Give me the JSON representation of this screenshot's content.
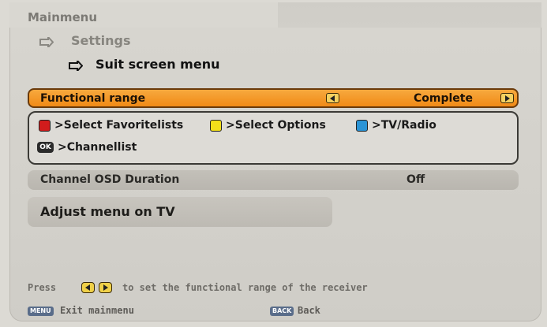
{
  "breadcrumb": {
    "main": "Mainmenu",
    "settings": "Settings",
    "current": "Suit screen menu"
  },
  "functional_range": {
    "label": "Functional range",
    "value": "Complete"
  },
  "legend": {
    "red": ">Select Favoritelists",
    "yellow": ">Select Options",
    "blue": ">TV/Radio",
    "ok_key": "OK",
    "ok": ">Channellist"
  },
  "osd": {
    "label": "Channel OSD Duration",
    "value": "Off"
  },
  "adjust": {
    "label": "Adjust menu on TV"
  },
  "help": {
    "pre": "Press",
    "post": "to set the functional range of the receiver"
  },
  "footer": {
    "menu_key": "MENU",
    "exit": "Exit mainmenu",
    "back_key": "BACK",
    "back": "Back"
  },
  "colors": {
    "highlight": "#f08a16",
    "red_key": "#d11c1c",
    "yellow_key": "#f2df1a",
    "blue_key": "#2a94d6"
  }
}
